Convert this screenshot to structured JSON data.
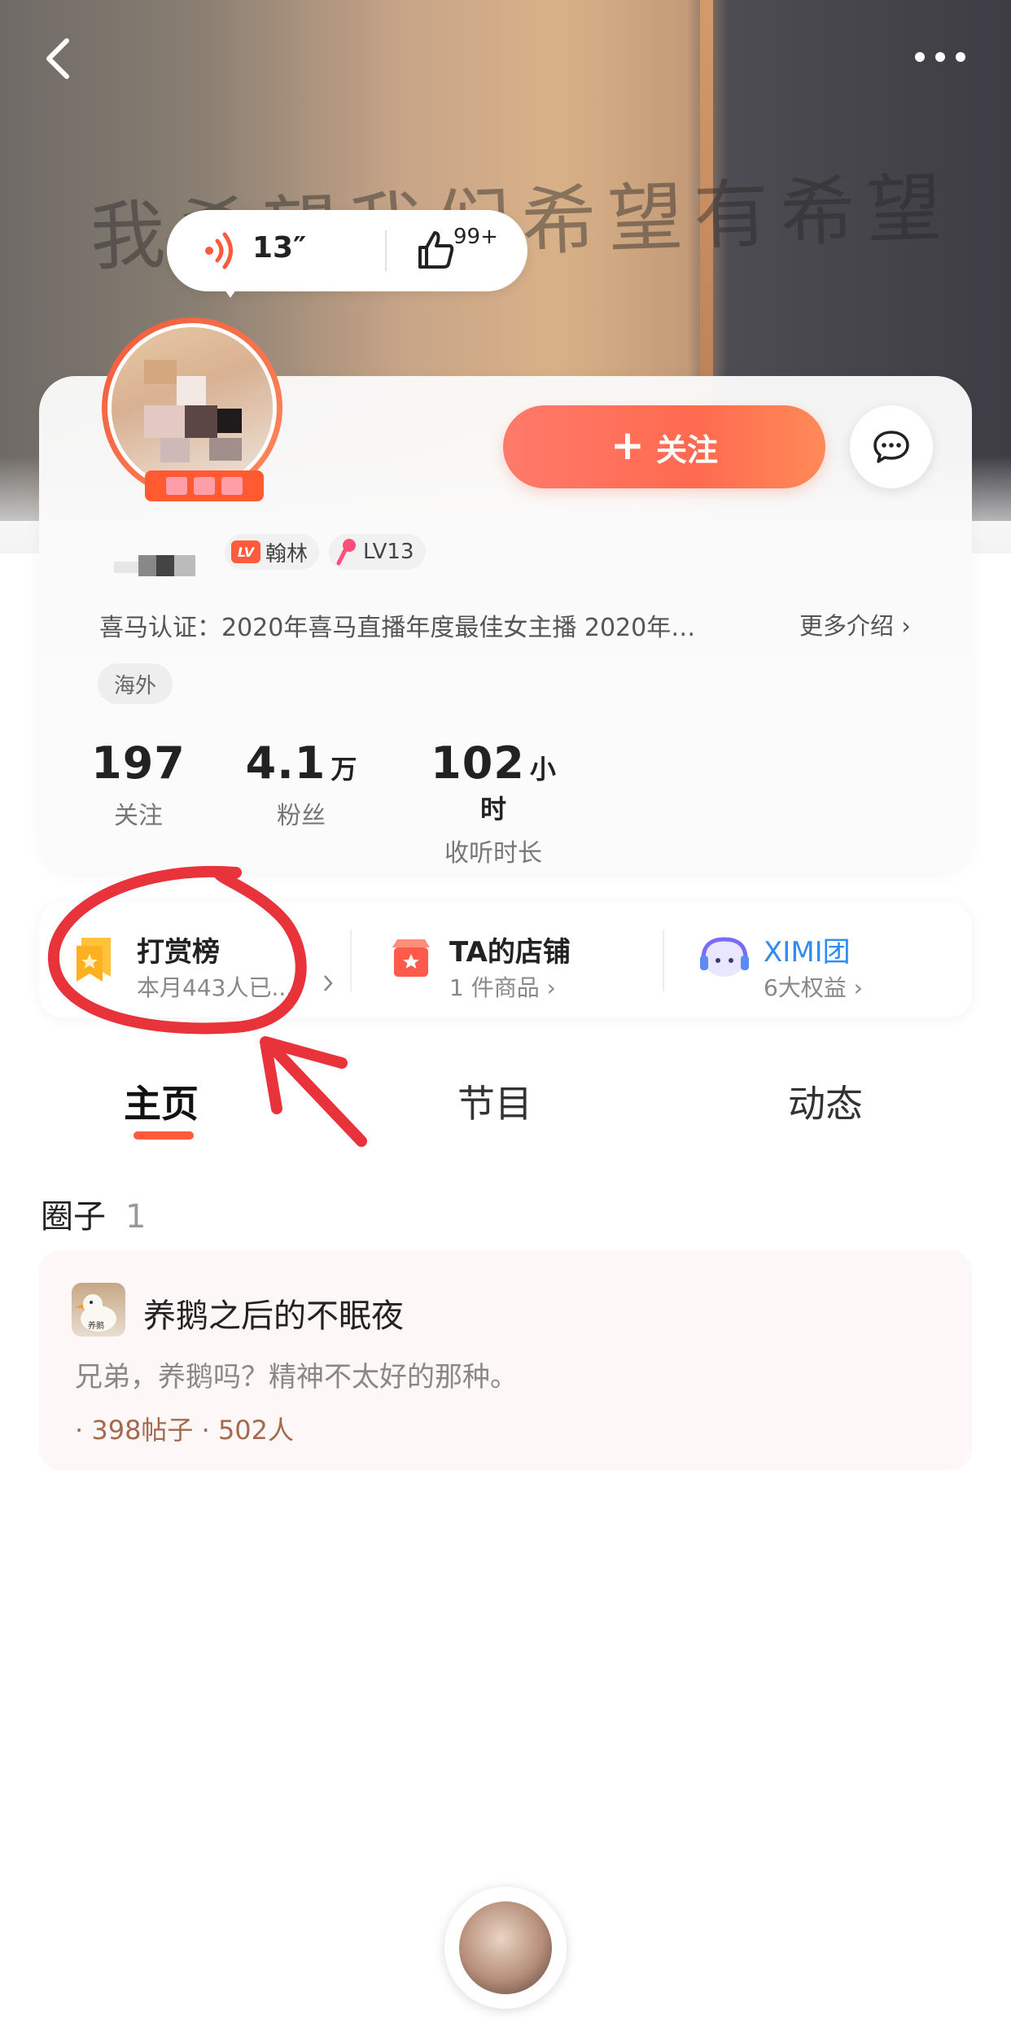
{
  "hero": {
    "scribble_text": "我希望我们希望有希望"
  },
  "voice": {
    "duration": "13″",
    "likes": "99+"
  },
  "profile": {
    "follow_label": "关注",
    "badges": [
      {
        "icon": "LV",
        "label": "翰林"
      },
      {
        "label": "LV13"
      }
    ],
    "certification": "喜马认证：2020年喜马直播年度最佳女主播  2020年…",
    "more_intro": "更多介绍 ›",
    "tag": "海外",
    "stats": [
      {
        "value": "197",
        "unit": "",
        "label": "关注"
      },
      {
        "value": "4.1",
        "unit": "万",
        "label": "粉丝"
      },
      {
        "value": "102",
        "unit": "小时",
        "label": "收听时长"
      }
    ]
  },
  "entries": [
    {
      "title": "打赏榜",
      "sub": "本月443人已..."
    },
    {
      "title": "TA的店铺",
      "sub": "1 件商品 ›"
    },
    {
      "title": "XIMI团",
      "sub": "6大权益 ›"
    }
  ],
  "tabs": [
    "主页",
    "节目",
    "动态"
  ],
  "circles": {
    "section_title": "圈子",
    "count": "1",
    "items": [
      {
        "thumb_text": "养鹅",
        "name": "养鹅之后的不眠夜",
        "desc": "兄弟，养鹅吗？精神不太好的那种。",
        "stats": "· 398帖子  · 502人"
      }
    ]
  },
  "colors": {
    "accent": "#ff5a3c",
    "follow_gradient_start": "#ff7a6a",
    "annotation_red": "#e8333a",
    "ximi_blue": "#2f8cf0"
  },
  "icons": {
    "back": "chevron-left-icon",
    "more": "more-dots-icon",
    "voice": "voice-wave-icon",
    "like": "thumb-up-icon",
    "message": "chat-bubble-icon",
    "reward": "reward-flag-icon",
    "shop": "shop-icon",
    "ximi": "ximi-mascot-icon"
  }
}
